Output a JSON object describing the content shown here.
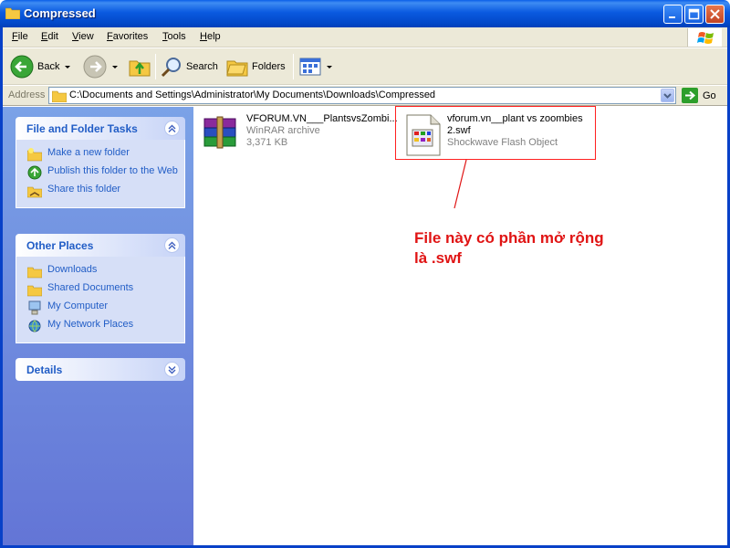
{
  "window": {
    "title": "Compressed"
  },
  "menu": [
    "File",
    "Edit",
    "View",
    "Favorites",
    "Tools",
    "Help"
  ],
  "toolbar": {
    "back": "Back",
    "search": "Search",
    "folders": "Folders"
  },
  "address": {
    "label": "Address",
    "path": "C:\\Documents and Settings\\Administrator\\My Documents\\Downloads\\Compressed",
    "go": "Go"
  },
  "panels": {
    "tasks": {
      "title": "File and Folder Tasks",
      "items": [
        "Make a new folder",
        "Publish this folder to the Web",
        "Share this folder"
      ]
    },
    "places": {
      "title": "Other Places",
      "items": [
        "Downloads",
        "Shared Documents",
        "My Computer",
        "My Network Places"
      ]
    },
    "details": {
      "title": "Details"
    }
  },
  "files": [
    {
      "name": "VFORUM.VN___PlantsvsZombi...",
      "type": "WinRAR archive",
      "size": "3,371 KB",
      "icon": "winrar-icon"
    },
    {
      "name": "vforum.vn__plant vs zoombies 2.swf",
      "type": "Shockwave Flash Object",
      "icon": "swf-file-icon"
    }
  ],
  "annotation": "File này có phần mở rộng là .swf",
  "colors": {
    "title_bar": "#0a5ae0",
    "task_pane": "#6375d6",
    "annotation": "#e01414"
  }
}
